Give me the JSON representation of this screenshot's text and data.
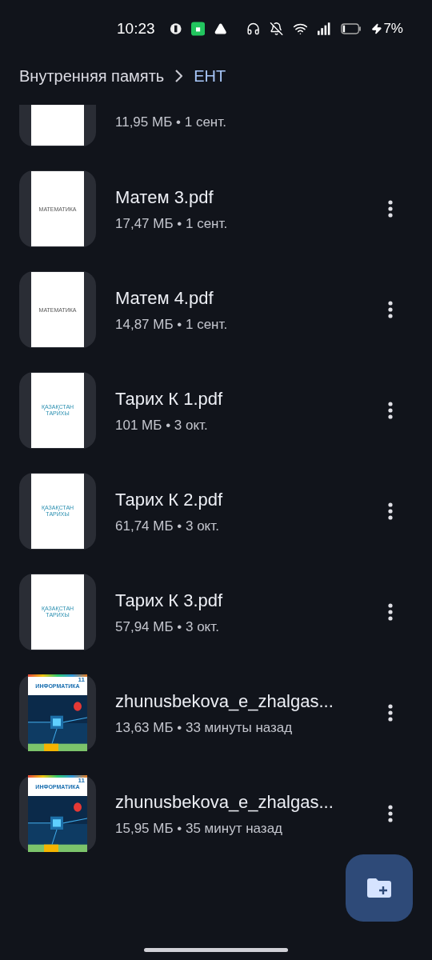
{
  "status_bar": {
    "time": "10:23",
    "battery": "7%"
  },
  "breadcrumb": [
    {
      "label": "Внутренняя память",
      "selected": false
    },
    {
      "label": "ЕНТ",
      "selected": true
    }
  ],
  "files": [
    {
      "details": "11,95 МБ • 1 сент.",
      "thumbnail": {
        "kind": "plain"
      }
    },
    {
      "name": "Матем 3.pdf",
      "details": "17,47 МБ • 1 сент.",
      "thumbnail": {
        "kind": "math",
        "title": "МАТЕМАТИКА"
      }
    },
    {
      "name": "Матем 4.pdf",
      "details": "14,87 МБ • 1 сент.",
      "thumbnail": {
        "kind": "math",
        "title": "МАТЕМАТИКА"
      }
    },
    {
      "name": "Тарих К 1.pdf",
      "details": "101 МБ • 3 окт.",
      "thumbnail": {
        "kind": "history",
        "title": "ҚАЗАҚСТАН ТАРИХЫ"
      }
    },
    {
      "name": "Тарих К 2.pdf",
      "details": "61,74 МБ • 3 окт.",
      "thumbnail": {
        "kind": "history",
        "title": "ҚАЗАҚСТАН ТАРИХЫ"
      }
    },
    {
      "name": "Тарих К 3.pdf",
      "details": "57,94 МБ • 3 окт.",
      "thumbnail": {
        "kind": "history",
        "title": "ҚАЗАҚСТАН ТАРИХЫ"
      }
    },
    {
      "name": "zhunusbekova_e_zhalgas...",
      "details": "13,63 МБ • 33 минуты назад",
      "thumbnail": {
        "kind": "informatics",
        "title": "ИНФОРМАТИКА",
        "grade": "11"
      }
    },
    {
      "name": "zhunusbekova_e_zhalgas...",
      "details": "15,95 МБ • 35 минут назад",
      "thumbnail": {
        "kind": "informatics",
        "title": "ИНФОРМАТИКА",
        "grade": "11"
      }
    }
  ]
}
